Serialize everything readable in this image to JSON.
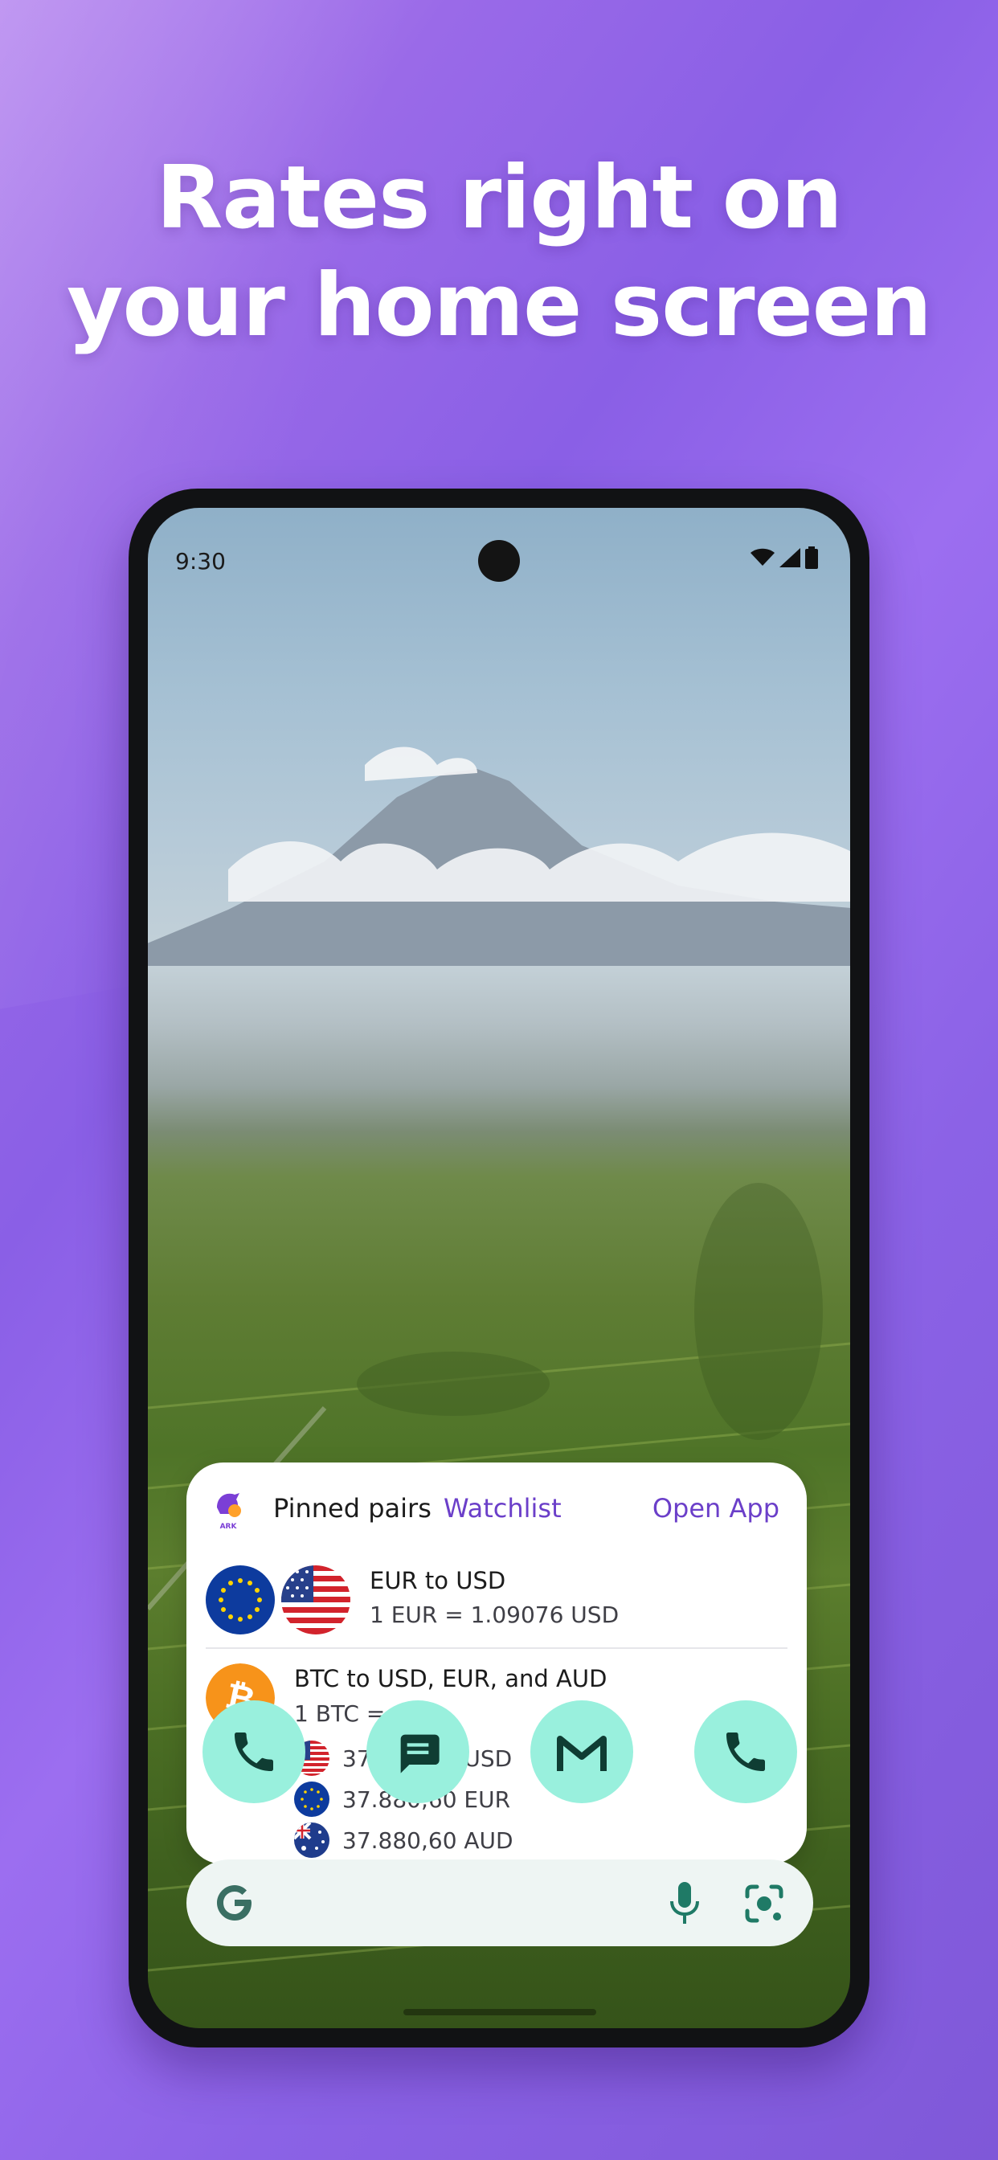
{
  "headline": {
    "line1": "Rates right on",
    "line2": "your home screen"
  },
  "status_bar": {
    "time": "9:30"
  },
  "widget": {
    "title": "Pinned pairs",
    "watchlist_tab": "Watchlist",
    "open_app": "Open App",
    "logo_text": "ARK",
    "pair1": {
      "title": "EUR to USD",
      "rate": "1 EUR = 1.09076 USD"
    },
    "pair2": {
      "title": "BTC to USD, EUR, and AUD",
      "subtitle": "1 BTC =",
      "conversions": [
        "37.880,60 USD",
        "37.880,60 EUR",
        "37.880,60 AUD"
      ]
    }
  },
  "dock": [
    "phone-icon",
    "messages-icon",
    "gmail-icon",
    "phone-icon"
  ],
  "search": {
    "g": "G"
  },
  "colors": {
    "accent": "#6b3fc9",
    "dock": "#99f0dd",
    "btc": "#f7931a",
    "eu_blue": "#0d3b9e"
  }
}
